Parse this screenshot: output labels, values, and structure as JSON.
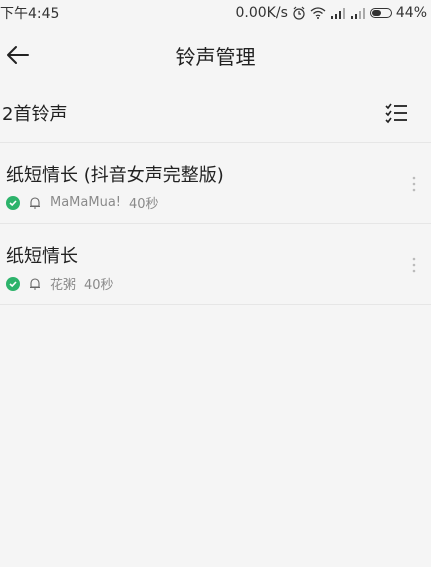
{
  "status": {
    "time": "下午4:45",
    "speed": "0.00K/s",
    "battery": "44%"
  },
  "header": {
    "title": "铃声管理"
  },
  "subbar": {
    "count": "2首铃声"
  },
  "ringtones": [
    {
      "name": "纸短情长 (抖音女声完整版)",
      "artist": "MaMaMua!",
      "duration": "40秒"
    },
    {
      "name": "纸短情长",
      "artist": "花粥",
      "duration": "40秒"
    }
  ],
  "colors": {
    "check": "#2db36b",
    "background": "#f5f5f5"
  }
}
